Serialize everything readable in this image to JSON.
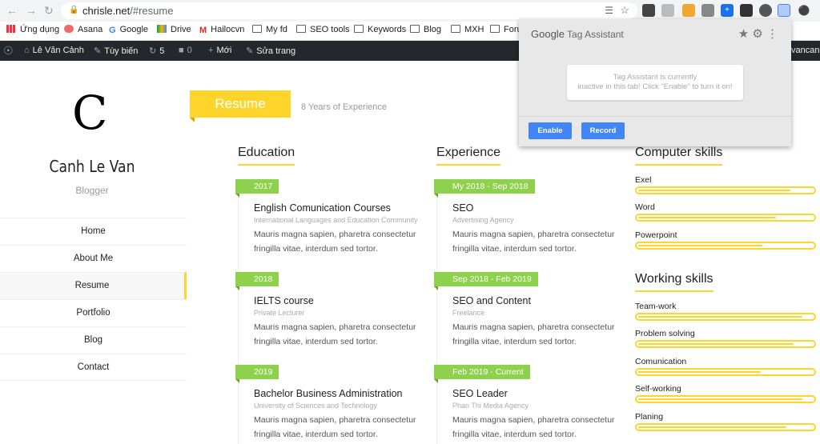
{
  "browser": {
    "url_host": "chrisle.net",
    "url_path": "/#resume",
    "bookmarks": [
      {
        "label": "Ứng dụng",
        "icon": "apps-grid-icon"
      },
      {
        "label": "Asana",
        "icon": "asana-icon"
      },
      {
        "label": "Google",
        "icon": "google-icon"
      },
      {
        "label": "Drive",
        "icon": "drive-icon"
      },
      {
        "label": "Hailocvn",
        "icon": "gmail-icon"
      },
      {
        "label": "My fd",
        "icon": "folder-icon"
      },
      {
        "label": "SEO tools",
        "icon": "folder-icon"
      },
      {
        "label": "Keywords",
        "icon": "folder-icon"
      },
      {
        "label": "Blog",
        "icon": "folder-icon"
      },
      {
        "label": "MXH",
        "icon": "folder-icon"
      },
      {
        "label": "Foru",
        "icon": "folder-icon"
      }
    ]
  },
  "adminbar": {
    "site_name": "Lê Văn Cảnh",
    "customize": "Tùy biến",
    "updates": "5",
    "comments": "0",
    "new": "Mới",
    "edit": "Sửa trang",
    "user": "vancanh"
  },
  "sidebar": {
    "logo_letter": "C",
    "name": "Canh Le Van",
    "role": "Blogger",
    "menu": [
      {
        "label": "Home"
      },
      {
        "label": "About Me"
      },
      {
        "label": "Resume"
      },
      {
        "label": "Portfolio"
      },
      {
        "label": "Blog"
      },
      {
        "label": "Contact"
      }
    ]
  },
  "resume": {
    "title": "Resume",
    "subtitle": "8 Years of Experience",
    "education_title": "Education",
    "experience_title": "Experience",
    "education": [
      {
        "date": "2017",
        "title": "English Comunication Courses",
        "org": "International Languages and Education Community",
        "desc": "Mauris magna sapien, pharetra consectetur fringilla vitae, interdum sed tortor."
      },
      {
        "date": "2018",
        "title": "IELTS course",
        "org": "Private Lecturer",
        "desc": "Mauris magna sapien, pharetra consectetur fringilla vitae, interdum sed tortor."
      },
      {
        "date": "2019",
        "title": "Bachelor Business Administration",
        "org": "University of Sciences and Technology",
        "desc": "Mauris magna sapien, pharetra consectetur fringilla vitae, interdum sed tortor."
      }
    ],
    "experience": [
      {
        "date": "My 2018 - Sep 2018",
        "title": "SEO",
        "org": "Advertising Agency",
        "desc": "Mauris magna sapien, pharetra consectetur fringilla vitae, interdum sed tortor."
      },
      {
        "date": "Sep 2018 - Feb 2019",
        "title": "SEO and Content",
        "org": "Freelance",
        "desc": "Mauris magna sapien, pharetra consectetur fringilla vitae, interdum sed tortor."
      },
      {
        "date": "Feb 2019 - Current",
        "title": "SEO Leader",
        "org": "Phan Thi Media Agency",
        "desc": "Mauris magna sapien, pharetra consectetur fringilla vitae, interdum sed tortor."
      }
    ],
    "computer_skills_title": "Computer skills",
    "computer_skills": [
      {
        "label": "Exel",
        "level": 0.87
      },
      {
        "label": "Word",
        "level": 0.79
      },
      {
        "label": "Powerpoint",
        "level": 0.71
      }
    ],
    "working_skills_title": "Working skills",
    "working_skills": [
      {
        "label": "Team-work",
        "level": 0.94
      },
      {
        "label": "Problem solving",
        "level": 0.89
      },
      {
        "label": "Comunication",
        "level": 0.7
      },
      {
        "label": "Self-working",
        "level": 0.94
      },
      {
        "label": "Planing",
        "level": 0.85
      }
    ],
    "accent_color": "#ffd52b",
    "tag_color": "#8ed14c"
  },
  "tag_assistant": {
    "brand_google": "Google",
    "brand_product": "Tag Assistant",
    "message_line1": "Tag Assistant is currently",
    "message_line2": "inactive in this tab! Click \"Enable\" to turn it on!",
    "enable_label": "Enable",
    "record_label": "Record"
  }
}
